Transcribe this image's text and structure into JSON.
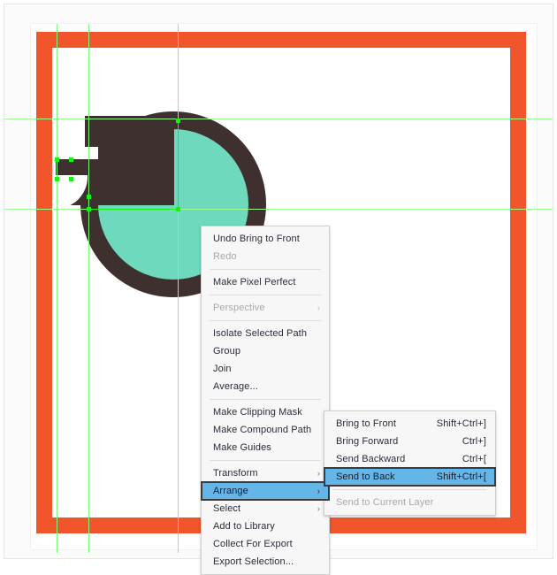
{
  "app": {
    "document_background": "#ffffff",
    "artboard_background": "#ffffff"
  },
  "artwork": {
    "name": "teapot-icon-artwork",
    "colors": {
      "frame_orange": "#f0552b",
      "kettle_dark": "#3e302e",
      "kettle_teal": "#6ed9bc",
      "guide_green": "#7dfb78",
      "anchor_green": "#18f018"
    },
    "shapes": [
      {
        "name": "orange-frame-rect",
        "type": "rectangle",
        "fill": "#f0552b"
      },
      {
        "name": "kettle-disc",
        "type": "circle",
        "fill": "#6ed9bc",
        "stroke": "#3e302e"
      },
      {
        "name": "kettle-body",
        "type": "path",
        "fill": "#3e302e"
      },
      {
        "name": "kettle-spout",
        "type": "path",
        "fill": "#3e302e"
      }
    ],
    "guides": {
      "vertical": [
        59,
        95,
        196
      ],
      "horizontal": [
        129,
        231
      ]
    }
  },
  "context_menu": {
    "name": "canvas-context-menu",
    "items": [
      {
        "label": "Undo Bring to Front",
        "accel": "",
        "disabled": false,
        "submenu": false,
        "highlight": false
      },
      {
        "label": "Redo",
        "accel": "",
        "disabled": true,
        "submenu": false,
        "highlight": false
      },
      {
        "separator": true
      },
      {
        "label": "Make Pixel Perfect",
        "accel": "",
        "disabled": false,
        "submenu": false,
        "highlight": false
      },
      {
        "separator": true
      },
      {
        "label": "Perspective",
        "accel": "",
        "disabled": true,
        "submenu": true,
        "highlight": false
      },
      {
        "separator": true
      },
      {
        "label": "Isolate Selected Path",
        "accel": "",
        "disabled": false,
        "submenu": false,
        "highlight": false
      },
      {
        "label": "Group",
        "accel": "",
        "disabled": false,
        "submenu": false,
        "highlight": false
      },
      {
        "label": "Join",
        "accel": "",
        "disabled": false,
        "submenu": false,
        "highlight": false
      },
      {
        "label": "Average...",
        "accel": "",
        "disabled": false,
        "submenu": false,
        "highlight": false
      },
      {
        "separator": true
      },
      {
        "label": "Make Clipping Mask",
        "accel": "",
        "disabled": false,
        "submenu": false,
        "highlight": false
      },
      {
        "label": "Make Compound Path",
        "accel": "",
        "disabled": false,
        "submenu": false,
        "highlight": false
      },
      {
        "label": "Make Guides",
        "accel": "",
        "disabled": false,
        "submenu": false,
        "highlight": false
      },
      {
        "separator": true
      },
      {
        "label": "Transform",
        "accel": "",
        "disabled": false,
        "submenu": true,
        "highlight": false
      },
      {
        "label": "Arrange",
        "accel": "",
        "disabled": false,
        "submenu": true,
        "highlight": true
      },
      {
        "label": "Select",
        "accel": "",
        "disabled": false,
        "submenu": true,
        "highlight": false
      },
      {
        "label": "Add to Library",
        "accel": "",
        "disabled": false,
        "submenu": false,
        "highlight": false
      },
      {
        "label": "Collect For Export",
        "accel": "",
        "disabled": false,
        "submenu": false,
        "highlight": false
      },
      {
        "label": "Export Selection...",
        "accel": "",
        "disabled": false,
        "submenu": false,
        "highlight": false
      }
    ]
  },
  "arrange_submenu": {
    "name": "arrange-submenu",
    "items": [
      {
        "label": "Bring to Front",
        "accel": "Shift+Ctrl+]",
        "disabled": false,
        "submenu": false,
        "highlight": false
      },
      {
        "label": "Bring Forward",
        "accel": "Ctrl+]",
        "disabled": false,
        "submenu": false,
        "highlight": false
      },
      {
        "label": "Send Backward",
        "accel": "Ctrl+[",
        "disabled": false,
        "submenu": false,
        "highlight": false
      },
      {
        "label": "Send to Back",
        "accel": "Shift+Ctrl+[",
        "disabled": false,
        "submenu": false,
        "highlight": true
      },
      {
        "separator": true
      },
      {
        "label": "Send to Current Layer",
        "accel": "",
        "disabled": true,
        "submenu": false,
        "highlight": false
      }
    ]
  },
  "icons": {
    "submenu_arrow": "›"
  }
}
